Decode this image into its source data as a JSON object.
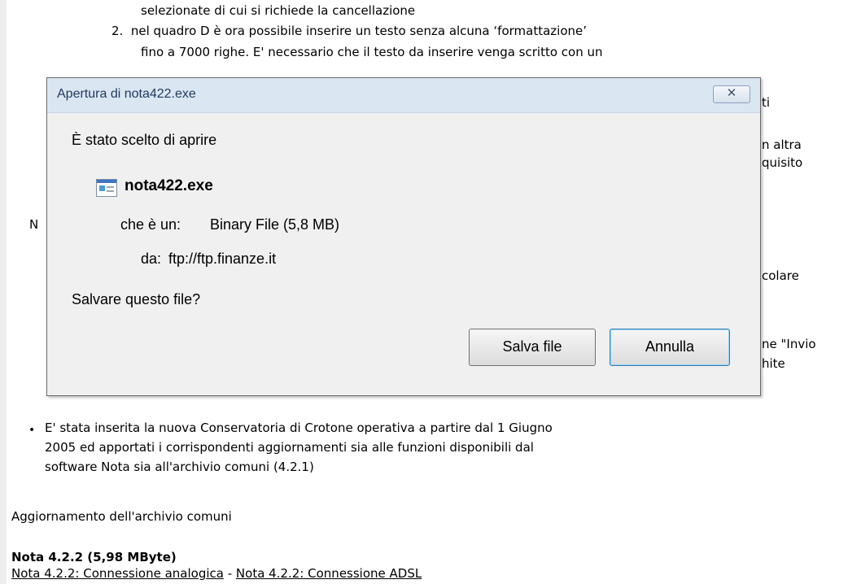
{
  "page": {
    "lines_top": [
      "selezionate di cui si richiede la cancellazione",
      "2.  nel quadro D è ora possibile inserire un testo senza alcuna ‘formattazione’",
      "fino a 7000 righe. E' necessario che il testo da inserire venga scritto con un"
    ],
    "right_fragments": [
      "ti",
      "n altra",
      "quisito",
      "colare",
      "ne \"Invio",
      "hite"
    ],
    "left_fragment": "N",
    "bullet_glyph": "•",
    "bullet_lines": [
      "E' stata inserita la nuova Conservatoria di Crotone operativa a partire dal 1 Giugno",
      "2005 ed apportati i corrispondenti aggiornamenti sia alle funzioni disponibili dal",
      "software Nota sia all'archivio comuni (4.2.1)"
    ],
    "section_text": "Aggiornamento dell'archivio comuni",
    "download_title": "Nota 4.2.2 (5,98 MByte)",
    "link_analog": "Nota 4.2.2: Connessione analogica",
    "link_separator": " - ",
    "link_adsl": "Nota 4.2.2: Connessione ADSL"
  },
  "dialog": {
    "title": "Apertura di nota422.exe",
    "close_symbol": "✕",
    "intro": "È stato scelto di aprire",
    "file_name": "nota422.exe",
    "type_label": "che è un:",
    "type_value": "Binary File (5,8 MB)",
    "from_label": "da:",
    "from_value": "ftp://ftp.finanze.it",
    "question": "Salvare questo file?",
    "save_label": "Salva file",
    "cancel_label": "Annulla"
  }
}
